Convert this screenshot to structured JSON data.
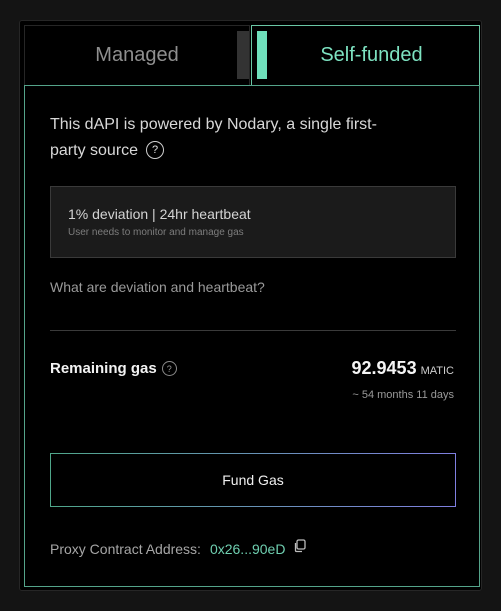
{
  "tabs": {
    "managed_label": "Managed",
    "self_funded_label": "Self-funded",
    "active": "Self-funded"
  },
  "intro": {
    "text": "This dAPI is powered by Nodary, a single first-party source",
    "help_icon": "question-circle-icon",
    "help_symbol": "?"
  },
  "info_box": {
    "title": "1% deviation | 24hr heartbeat",
    "subtitle": "User needs to monitor and manage gas"
  },
  "help_link": "What are deviation and heartbeat?",
  "gas": {
    "label": "Remaining gas",
    "help_symbol": "?",
    "value": "92.9453",
    "unit": "MATIC",
    "time_remaining": "~ 54 months 11 days"
  },
  "fund_button": {
    "label": "Fund Gas"
  },
  "proxy": {
    "label": "Proxy Contract Address:",
    "address": "0x26...90eD",
    "copy_icon": "copy-icon"
  },
  "colors": {
    "accent": "#7de2c1",
    "panel_border": "#54a48a",
    "button_gradient_start": "#4fa68a",
    "button_gradient_end": "#7f7fe0"
  }
}
